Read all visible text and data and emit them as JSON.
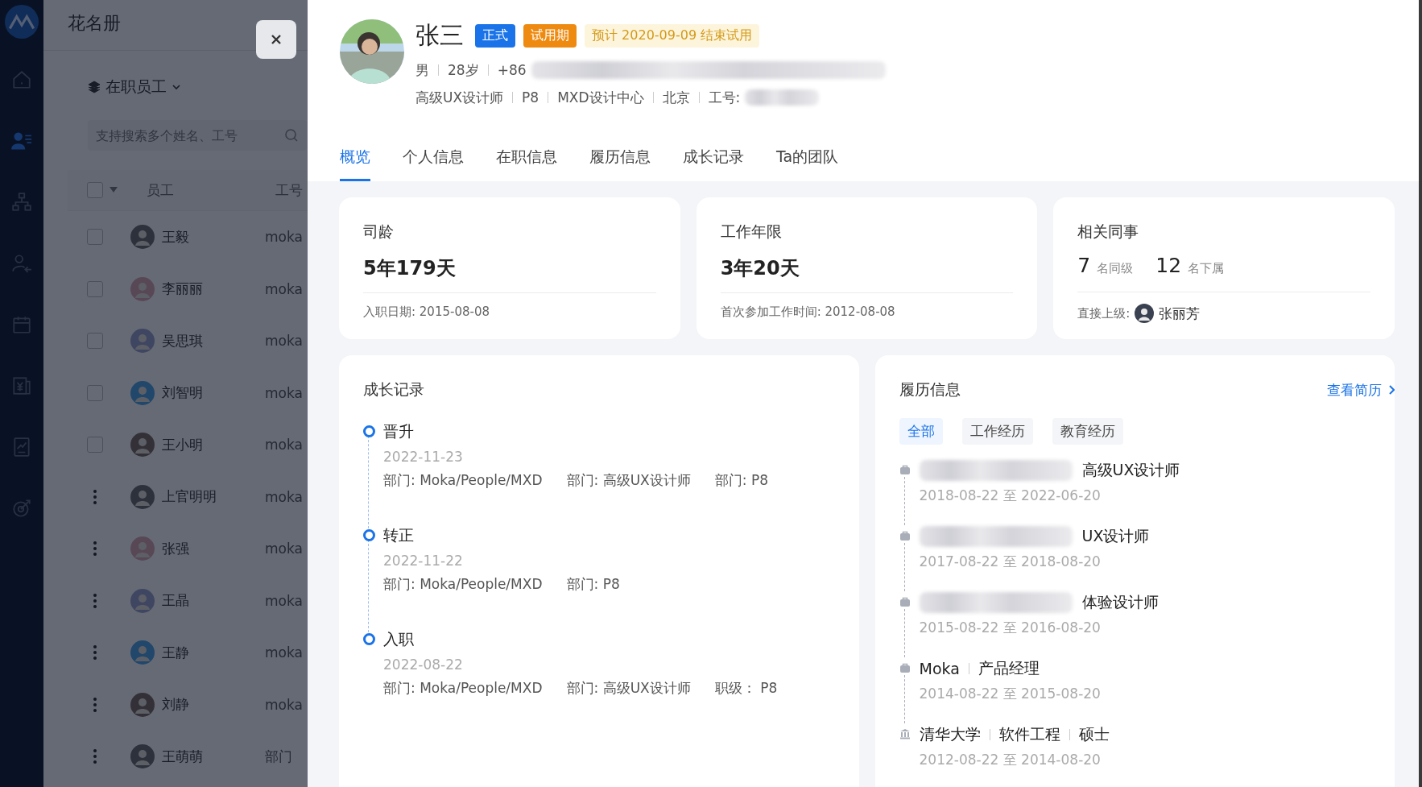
{
  "nav_rail": {
    "items": [
      {
        "selected": false
      },
      {
        "selected": true
      },
      {
        "selected": false
      },
      {
        "selected": false
      },
      {
        "selected": false
      },
      {
        "selected": false
      },
      {
        "selected": false
      },
      {
        "selected": false
      }
    ]
  },
  "roster": {
    "title": "花名册",
    "filter": "在职员工",
    "search": {
      "placeholder": "支持搜索多个姓名、工号"
    },
    "columns": [
      "员工",
      "工号"
    ],
    "select_all": {
      "checked": false
    },
    "rows": [
      {
        "kind": "checkbox",
        "checked": false,
        "name": "王毅",
        "id": "moka"
      },
      {
        "kind": "checkbox",
        "checked": false,
        "name": "李丽丽",
        "id": "moka"
      },
      {
        "kind": "checkbox",
        "checked": false,
        "name": "吴思琪",
        "id": "moka"
      },
      {
        "kind": "checkbox",
        "checked": false,
        "name": "刘智明",
        "id": "moka"
      },
      {
        "kind": "checkbox",
        "checked": false,
        "name": "王小明",
        "id": "moka"
      },
      {
        "kind": "menu",
        "name": "上官明明",
        "id": "moka"
      },
      {
        "kind": "menu",
        "name": "张强",
        "id": "moka"
      },
      {
        "kind": "menu",
        "name": "王晶",
        "id": "moka"
      },
      {
        "kind": "menu",
        "name": "王静",
        "id": "moka"
      },
      {
        "kind": "menu",
        "name": "刘静",
        "id": "moka"
      },
      {
        "kind": "menu",
        "name": "王萌萌",
        "id": "部门"
      }
    ]
  },
  "profile": {
    "name": "张三",
    "tags": [
      {
        "text": "正式",
        "kind": "primary"
      },
      {
        "text": "试用期",
        "kind": "warning"
      },
      {
        "text": "预计 2020-09-09 结束试用",
        "kind": "notice"
      }
    ],
    "meta_line_1": [
      {
        "text": "男",
        "redacted": false
      },
      {
        "text": "28岁",
        "redacted": false
      },
      {
        "text": "+86",
        "redacted": true
      }
    ],
    "meta_line_2": [
      {
        "text": "高级UX设计师",
        "redacted": false
      },
      {
        "text": "P8",
        "redacted": false
      },
      {
        "text": "MXD设计中心",
        "redacted": false
      },
      {
        "text": "北京",
        "redacted": false
      },
      {
        "text": "工号:",
        "redacted": true
      }
    ]
  },
  "tabs": [
    {
      "label": "概览",
      "selected": true
    },
    {
      "label": "个人信息",
      "selected": false
    },
    {
      "label": "在职信息",
      "selected": false
    },
    {
      "label": "履历信息",
      "selected": false
    },
    {
      "label": "成长记录",
      "selected": false
    },
    {
      "label": "Ta的团队",
      "selected": false
    }
  ],
  "stat_cards": [
    {
      "kind": "value",
      "title": "司龄",
      "value": "5年179天",
      "footer": "入职日期: 2015-08-08"
    },
    {
      "kind": "value",
      "title": "工作年限",
      "value": "3年20天",
      "footer": "首次参加工作时间: 2012-08-08"
    },
    {
      "kind": "colleagues",
      "title": "相关同事",
      "counts": [
        {
          "number": "7",
          "label": "名同级"
        },
        {
          "number": "12",
          "label": "名下属"
        }
      ],
      "footer": "直接上级:",
      "manager": "张丽芳"
    }
  ],
  "growth_record": {
    "title": "成长记录",
    "items": [
      {
        "title": "晋升",
        "date": "2022-11-23",
        "fields": [
          "部门: Moka/People/MXD",
          "部门: 高级UX设计师",
          "部门: P8"
        ]
      },
      {
        "title": "转正",
        "date": "2022-11-22",
        "fields": [
          "部门: Moka/People/MXD",
          "部门: P8"
        ]
      },
      {
        "title": "入职",
        "date": "2022-08-22",
        "fields": [
          "部门: Moka/People/MXD",
          "部门: 高级UX设计师",
          "职级： P8"
        ]
      }
    ]
  },
  "resume": {
    "title": "履历信息",
    "link": "查看简历",
    "filters": [
      {
        "label": "全部",
        "selected": true
      },
      {
        "label": "工作经历",
        "selected": false
      },
      {
        "label": "教育经历",
        "selected": false
      }
    ],
    "entries": [
      {
        "kind": "work",
        "redacted": true,
        "parts": [
          "高级UX设计师"
        ],
        "date": "2018-08-22 至 2022-06-20"
      },
      {
        "kind": "work",
        "redacted": true,
        "parts": [
          "UX设计师"
        ],
        "date": "2017-08-22 至 2018-08-20"
      },
      {
        "kind": "work",
        "redacted": true,
        "parts": [
          "体验设计师"
        ],
        "date": "2015-08-22 至 2016-08-20"
      },
      {
        "kind": "work",
        "redacted": false,
        "parts": [
          "Moka",
          "产品经理"
        ],
        "date": "2014-08-22 至 2015-08-20"
      },
      {
        "kind": "education",
        "redacted": false,
        "parts": [
          "清华大学",
          "软件工程",
          "硕士"
        ],
        "date": "2012-08-22 至 2014-08-20"
      }
    ]
  }
}
